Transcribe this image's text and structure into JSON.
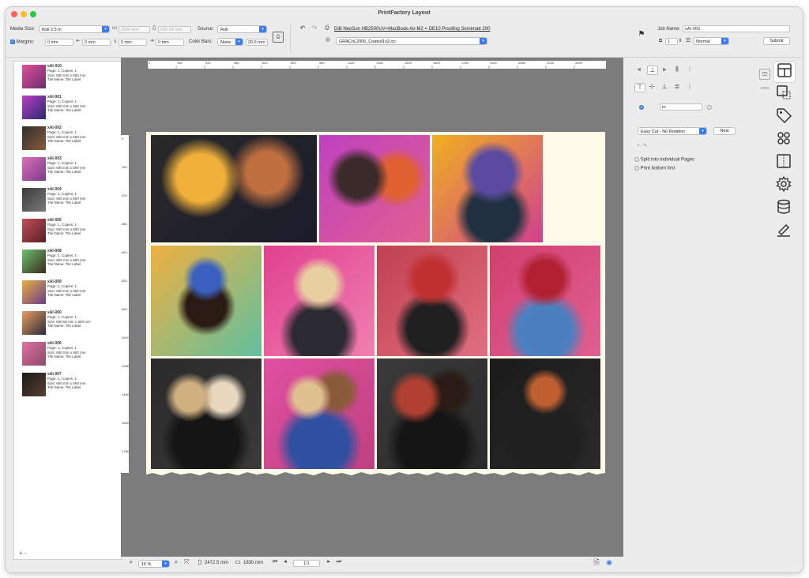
{
  "window": {
    "title": "PrintFactory Layout"
  },
  "toolbar": {
    "media_size_label": "Media Size:",
    "media_size_value": "Roll 2.5 m",
    "width_value": "2500 mm",
    "length_value": "500.00 mm",
    "source_label": "Source:",
    "source_value": "Roll",
    "margins_label": "Margins:",
    "margin_top": "0 mm",
    "margin_left": "0 mm",
    "margin_bottom": "0 mm",
    "margin_right": "0 mm",
    "color_bars_label": "Color Bars:",
    "color_bars_value": "None",
    "color_bars_size": "20.6 mm",
    "printer_link": "Dilli NeoSun HB2500UV=MacBook-Air-M2 = DE10 Proofing Semimatt 200",
    "profile_value": "GRACoL2006_Coated1v2.icc",
    "job_name_label": "Job Name:",
    "job_name_value": "xAI-000",
    "copies_value": "1",
    "priority_value": "Normal",
    "submit_label": "Submit"
  },
  "jobs": [
    {
      "name": "xAI-010",
      "l1": "Page: 1, Copies: 1",
      "l2": "Size: 600 mm x 600 mm",
      "l3": "Tile Name: Tile Label"
    },
    {
      "name": "xAI-001",
      "l1": "Page: 1, Copies: 1",
      "l2": "Size: 600 mm x 600 mm",
      "l3": "Tile Name: Tile Label"
    },
    {
      "name": "xAI-002",
      "l1": "Page: 1, Copies: 1",
      "l2": "Size: 600 mm x 600 mm",
      "l3": "Tile Name: Tile Label"
    },
    {
      "name": "xAI-003",
      "l1": "Page: 1, Copies: 1",
      "l2": "Size: 600 mm x 600 mm",
      "l3": "Tile Name: Tile Label"
    },
    {
      "name": "xAI-004",
      "l1": "Page: 1, Copies: 1",
      "l2": "Size: 600 mm x 600 mm",
      "l3": "Tile Name: Tile Label"
    },
    {
      "name": "xAI-005",
      "l1": "Page: 1, Copies: 1",
      "l2": "Size: 600 mm x 600 mm",
      "l3": "Tile Name: Tile Label"
    },
    {
      "name": "xAI-008",
      "l1": "Page: 1, Copies: 1",
      "l2": "Size: 600 mm x 600 mm",
      "l3": "Tile Name: Tile Label"
    },
    {
      "name": "xAI-009",
      "l1": "Page: 1, Copies: 1",
      "l2": "Size: 600 mm x 600 mm",
      "l3": "Tile Name: Tile Label"
    },
    {
      "name": "xAI-000",
      "l1": "Page: 1, Copies: 1",
      "l2": "Size: 600.86 mm x 600 mm",
      "l3": "Tile Name: Tile Label"
    },
    {
      "name": "xAI-006",
      "l1": "Page: 1, Copies: 1",
      "l2": "Size: 600 mm x 600 mm",
      "l3": "Tile Name: Tile Label"
    },
    {
      "name": "xAI-007",
      "l1": "Page: 1, Copies: 1",
      "l2": "Size: 600 mm x 600 mm",
      "l3": "Tile Name: Tile Label"
    }
  ],
  "ruler": {
    "h_ticks": [
      "0",
      "160",
      "320",
      "480",
      "640",
      "800",
      "960",
      "1120",
      "1280",
      "1440",
      "1600",
      "1760",
      "1920",
      "2080",
      "2240",
      "2400"
    ],
    "v_ticks": [
      "0",
      "160",
      "320",
      "480",
      "640",
      "800",
      "960",
      "1120",
      "1280",
      "1440",
      "1600",
      "1760"
    ]
  },
  "status": {
    "zoom_value": "16 %",
    "sheet_width": "2472.5 mm",
    "sheet_height": "1830 mm",
    "page_value": "1/1"
  },
  "nesting": {
    "to_value": "to",
    "cut_mode": "Easy Cut - No Rotation",
    "nest_label": "Nest",
    "split_label": "Split into individual Pages",
    "print_bottom_label": "Print bottom first"
  },
  "colors": {
    "accent": "#3a7bf6",
    "canvas_bg": "#7c7c7c",
    "sheet": "#fffbea"
  }
}
